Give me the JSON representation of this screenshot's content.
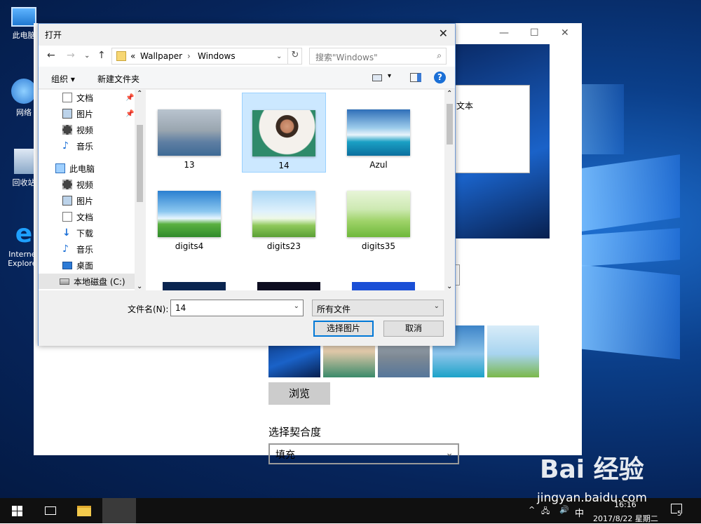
{
  "desktop": {
    "icons": [
      "此电脑",
      "网络",
      "回收站",
      "Internet Explorer"
    ]
  },
  "settings_window": {
    "preview_text": "文本",
    "browse_label": "浏览",
    "fit_label": "选择契合度",
    "fit_value": "填充"
  },
  "dialog": {
    "title": "打开",
    "breadcrumb_prefix": "«",
    "breadcrumb": [
      "Wallpaper",
      "Windows"
    ],
    "search_placeholder": "搜索\"Windows\"",
    "toolbar": {
      "organize": "组织 ▾",
      "new_folder": "新建文件夹",
      "help": "?"
    },
    "nav": [
      {
        "label": "文档",
        "pinned": true
      },
      {
        "label": "图片",
        "pinned": true
      },
      {
        "label": "视频"
      },
      {
        "label": "音乐"
      },
      {
        "label": "此电脑"
      },
      {
        "label": "视频"
      },
      {
        "label": "图片"
      },
      {
        "label": "文档"
      },
      {
        "label": "下载"
      },
      {
        "label": "音乐"
      },
      {
        "label": "桌面"
      },
      {
        "label": "本地磁盘 (C:)"
      }
    ],
    "files": [
      {
        "name": "13",
        "selected": false
      },
      {
        "name": "14",
        "selected": true
      },
      {
        "name": "Azul",
        "selected": false
      },
      {
        "name": "digits4",
        "selected": false
      },
      {
        "name": "digits23",
        "selected": false
      },
      {
        "name": "digits35",
        "selected": false
      }
    ],
    "filename_label": "文件名(N):",
    "filename_value": "14",
    "filetype_value": "所有文件",
    "open_button": "选择图片",
    "cancel_button": "取消"
  },
  "taskbar": {
    "time": "16:16",
    "date": "2017/8/22 星期二",
    "ime": "中",
    "notifications": "5"
  },
  "watermark": {
    "logo": "Bai 经验",
    "url": "jingyan.baidu.com"
  }
}
